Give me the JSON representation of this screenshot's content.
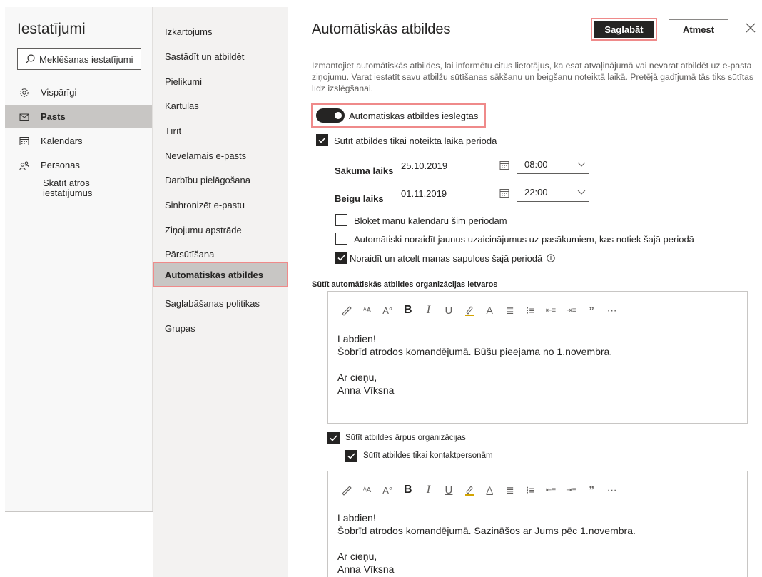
{
  "sidebar": {
    "title": "Iestatījumi",
    "search_placeholder": "Meklēšanas iestatījumi",
    "items": [
      {
        "label": "Vispārīgi",
        "icon": "gear-icon"
      },
      {
        "label": "Pasts",
        "icon": "mail-icon"
      },
      {
        "label": "Kalendārs",
        "icon": "calendar-icon"
      },
      {
        "label": "Personas",
        "icon": "people-icon"
      }
    ],
    "quick_settings_label": "Skatīt ātros iestatījumus"
  },
  "mail_nav": {
    "items": [
      "Izkārtojums",
      "Sastādīt un atbildēt",
      "Pielikumi",
      "Kārtulas",
      "Tīrīt",
      "Nevēlamais e-pasts",
      "Darbību pielāgošana",
      "Sinhronizēt e-pastu",
      "Ziņojumu apstrāde",
      "Pārsūtīšana",
      "Automātiskās atbildes",
      "Saglabāšanas politikas",
      "Grupas"
    ],
    "selected": "Automātiskās atbildes"
  },
  "pane": {
    "title": "Automātiskās atbildes",
    "save_label": "Saglabāt",
    "discard_label": "Atmest",
    "description": "Izmantojiet automātiskās atbildes, lai informētu citus lietotājus, ka esat atvaļinājumā vai nevarat atbildēt uz e-pasta ziņojumu. Varat iestatīt savu atbilžu sūtīšanas sākšanu un beigšanu noteiktā laikā. Pretējā gadījumā tās tiks sūtītas līdz izslēgšanai.",
    "toggle_label": "Automātiskās atbildes ieslēgtas",
    "toggle_on": true,
    "time_period_label": "Sūtīt atbildes tikai noteiktā laika periodā",
    "start_label": "Sākuma laiks",
    "start_date": "25.10.2019",
    "start_time": "08:00",
    "end_label": "Beigu laiks",
    "end_date": "01.11.2019",
    "end_time": "22:00",
    "block_calendar_label": "Bloķēt manu kalendāru šim periodam",
    "decline_invites_label": "Automātiski noraidīt jaunus uzaicinājumus uz pasākumiem, kas notiek šajā periodā",
    "cancel_meetings_label": "Noraidīt un atcelt manas sapulces šajā periodā",
    "inside_org_label": "Sūtīt automātiskās atbildes organizācijas ietvaros",
    "inside_message": {
      "line1": "Labdien!",
      "line2": "Šobrīd atrodos komandējumā. Būšu pieejama no 1.novembra.",
      "line3": "Ar cieņu,",
      "line4": "Anna Vīksna"
    },
    "outside_org_label": "Sūtīt atbildes ārpus organizācijas",
    "contacts_only_label": "Sūtīt atbildes tikai kontaktpersonām",
    "outside_message": {
      "line1": "Labdien!",
      "line2": "Šobrīd atrodos komandējumā. Sazināšos ar Jums pēc 1.novembra.",
      "line3": "Ar cieņu,",
      "line4": "Anna Vīksna"
    }
  },
  "colors": {
    "accent_dark": "#252423",
    "highlight_border": "#ef8a8a",
    "selected_bg": "#c8c6c4"
  }
}
